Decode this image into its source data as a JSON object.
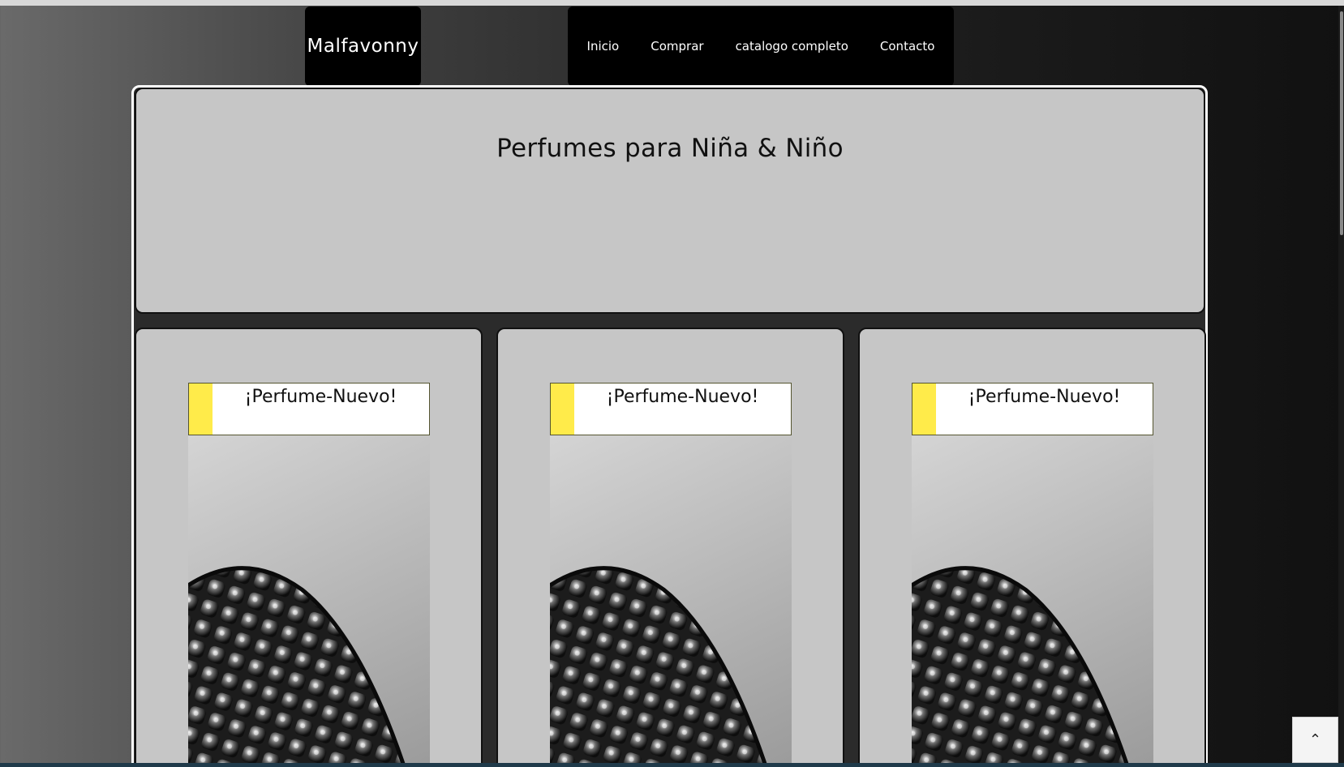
{
  "brand": {
    "name": "Malfavonny"
  },
  "nav": {
    "items": [
      {
        "label": "Inicio"
      },
      {
        "label": "Comprar"
      },
      {
        "label": "catalogo completo"
      },
      {
        "label": "Contacto"
      }
    ]
  },
  "hero": {
    "title": "Perfumes para Niña & Niño"
  },
  "products": [
    {
      "badge": "¡Perfume-Nuevo!",
      "image": "perfume-bottle-image"
    },
    {
      "badge": "¡Perfume-Nuevo!",
      "image": "perfume-bottle-image"
    },
    {
      "badge": "¡Perfume-Nuevo!",
      "image": "perfume-bottle-image"
    }
  ],
  "back_to_top": {
    "icon": "chevron-up-icon",
    "glyph": "⌃"
  },
  "colors": {
    "badge_stripe": "#ffeb4a",
    "panel": "#c6c6c6",
    "header_box": "#000000"
  }
}
